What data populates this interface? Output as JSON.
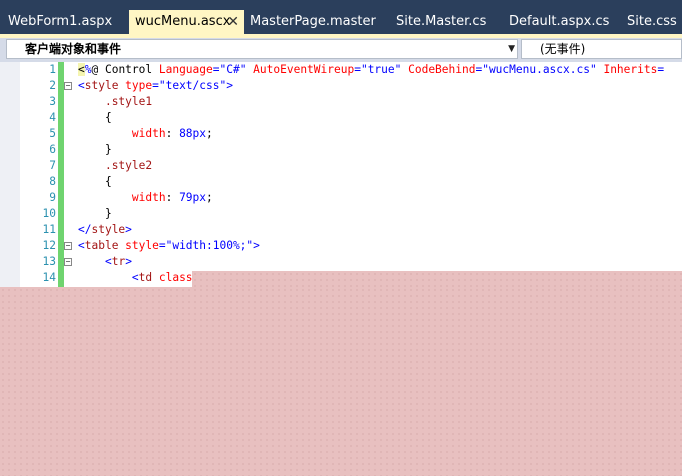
{
  "tabs": [
    {
      "label": "WebForm1.aspx",
      "active": false
    },
    {
      "label": "wucMenu.ascx",
      "active": true
    },
    {
      "label": "MasterPage.master",
      "active": false
    },
    {
      "label": "Site.Master.cs",
      "active": false
    },
    {
      "label": "Default.aspx.cs",
      "active": false
    },
    {
      "label": "Site.css",
      "active": false
    }
  ],
  "nav": {
    "object_combo": "客户端对象和事件",
    "event_combo": "(无事件)"
  },
  "colors": {
    "tab_bar": "#2b3f5c",
    "active_tab": "#fff6c4",
    "change_bar": "#6fd46f",
    "line_numbers": "#2b91af"
  },
  "lines": [
    {
      "n": "1",
      "segs": [
        [
          "hl",
          "<"
        ],
        [
          "v",
          "%"
        ],
        [
          "p",
          "@ Control "
        ],
        [
          "a",
          "Language"
        ],
        [
          "v",
          "=\"C#\" "
        ],
        [
          "a",
          "AutoEventWireup"
        ],
        [
          "v",
          "=\"true\" "
        ],
        [
          "a",
          "CodeBehind"
        ],
        [
          "v",
          "=\"wucMenu.ascx.cs\" "
        ],
        [
          "a",
          "Inherits"
        ],
        [
          "v",
          "="
        ]
      ]
    },
    {
      "n": "2",
      "segs": [
        [
          "v",
          "<"
        ],
        [
          "k",
          "style "
        ],
        [
          "a",
          "type"
        ],
        [
          "v",
          "=\"text/css\">"
        ]
      ]
    },
    {
      "n": "3",
      "segs": [
        [
          "p",
          "    "
        ],
        [
          "k",
          ".style1"
        ]
      ]
    },
    {
      "n": "4",
      "segs": [
        [
          "p",
          "    {"
        ]
      ]
    },
    {
      "n": "5",
      "segs": [
        [
          "p",
          "        "
        ],
        [
          "a",
          "width"
        ],
        [
          "p",
          ": "
        ],
        [
          "v",
          "88px"
        ],
        [
          "p",
          ";"
        ]
      ]
    },
    {
      "n": "6",
      "segs": [
        [
          "p",
          "    }"
        ]
      ]
    },
    {
      "n": "7",
      "segs": [
        [
          "p",
          "    "
        ],
        [
          "k",
          ".style2"
        ]
      ]
    },
    {
      "n": "8",
      "segs": [
        [
          "p",
          "    {"
        ]
      ]
    },
    {
      "n": "9",
      "segs": [
        [
          "p",
          "        "
        ],
        [
          "a",
          "width"
        ],
        [
          "p",
          ": "
        ],
        [
          "v",
          "79px"
        ],
        [
          "p",
          ";"
        ]
      ]
    },
    {
      "n": "10",
      "segs": [
        [
          "p",
          "    }"
        ]
      ]
    },
    {
      "n": "11",
      "segs": [
        [
          "v",
          "</"
        ],
        [
          "k",
          "style"
        ],
        [
          "v",
          ">"
        ]
      ]
    },
    {
      "n": "12",
      "segs": [
        [
          "v",
          "<"
        ],
        [
          "k",
          "table "
        ],
        [
          "a",
          "style"
        ],
        [
          "v",
          "=\"width:100%;\">"
        ]
      ]
    },
    {
      "n": "13",
      "segs": [
        [
          "p",
          "    "
        ],
        [
          "v",
          "<"
        ],
        [
          "k",
          "tr"
        ],
        [
          "v",
          ">"
        ]
      ]
    },
    {
      "n": "14",
      "segs": [
        [
          "p",
          "        "
        ],
        [
          "v",
          "<"
        ],
        [
          "k",
          "td "
        ],
        [
          "a",
          "class"
        ],
        [
          "v",
          "=\""
        ]
      ]
    }
  ]
}
